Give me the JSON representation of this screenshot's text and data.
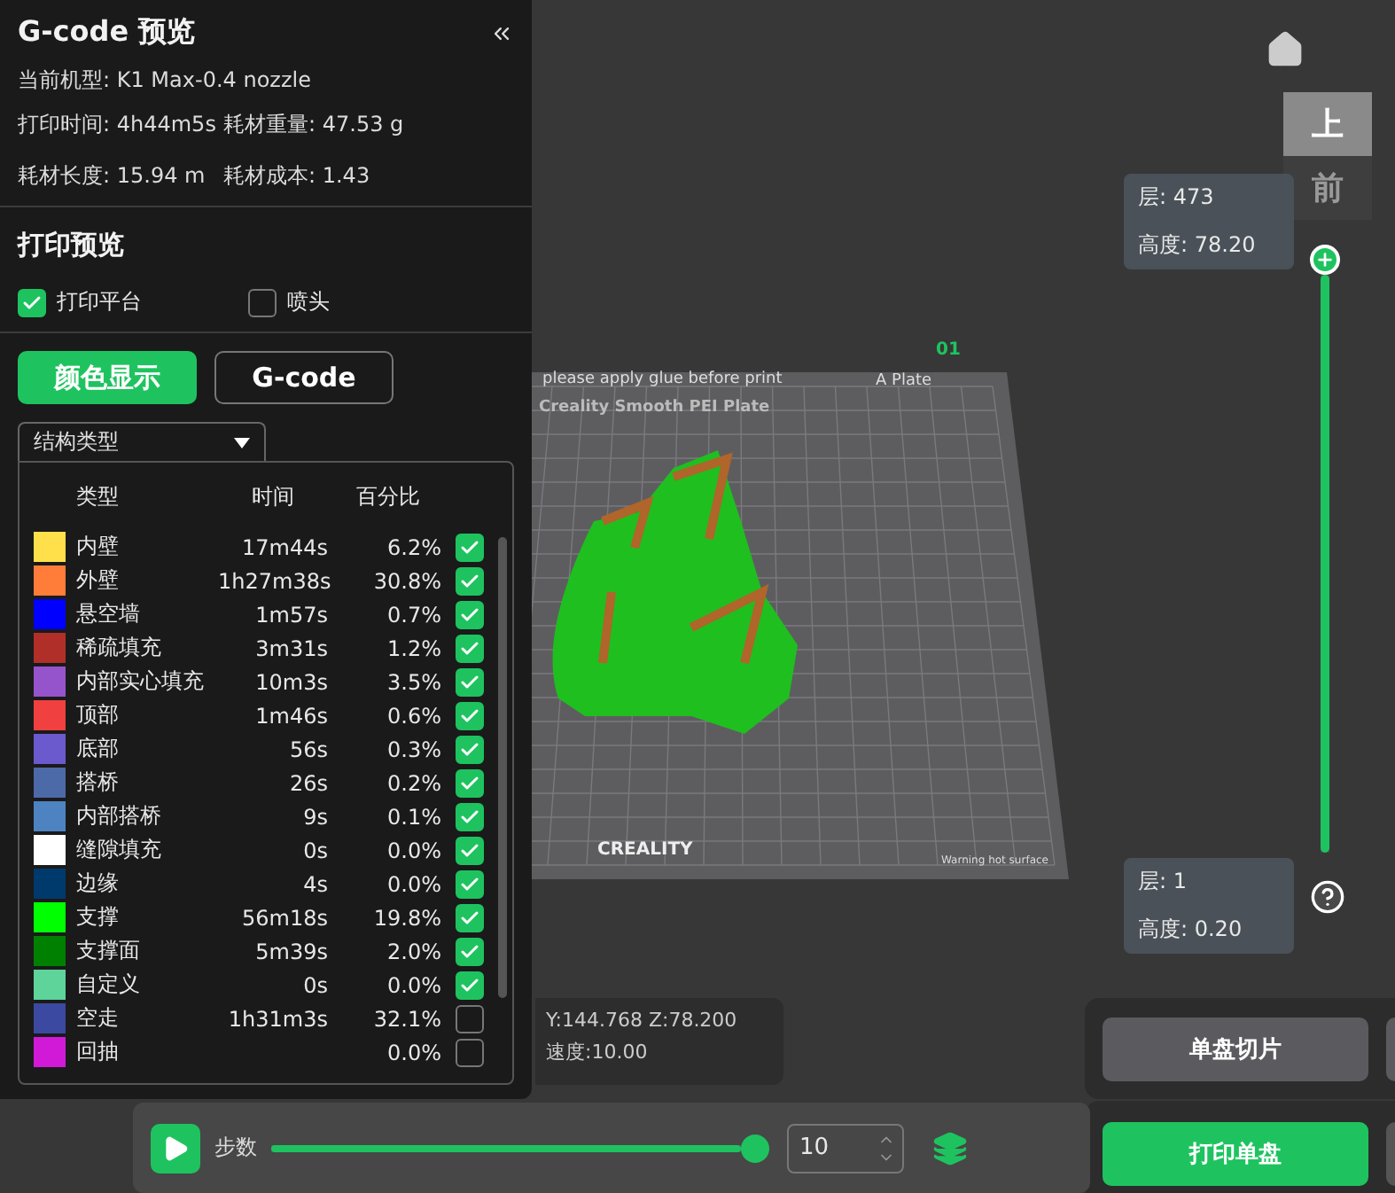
{
  "panel": {
    "title": "G-code 预览",
    "machine": "当前机型: K1 Max-0.4 nozzle",
    "stats": [
      "打印时间: 4h44m5s",
      "耗材重量: 47.53 g",
      "耗材长度: 15.94 m",
      "耗材成本: 1.43"
    ],
    "preview_title": "打印预览",
    "toggles": [
      {
        "label": "打印平台",
        "checked": true
      },
      {
        "label": "喷头",
        "checked": false
      }
    ],
    "modes": [
      {
        "label": "颜色显示",
        "selected": true
      },
      {
        "label": "G-code",
        "selected": false
      }
    ],
    "view_select": "结构类型",
    "legend": {
      "columns": [
        "类型",
        "时间",
        "百分比"
      ],
      "rows": [
        {
          "name": "内壁",
          "time": "17m44s",
          "percent": "6.2%",
          "color": "#ffe04a",
          "checked": true
        },
        {
          "name": "外壁",
          "time": "1h27m38s",
          "percent": "30.8%",
          "color": "#ff7d38",
          "checked": true
        },
        {
          "name": "悬空墙",
          "time": "1m57s",
          "percent": "0.7%",
          "color": "#0000ff",
          "checked": true
        },
        {
          "name": "稀疏填充",
          "time": "3m31s",
          "percent": "1.2%",
          "color": "#b03029",
          "checked": true
        },
        {
          "name": "内部实心填充",
          "time": "10m3s",
          "percent": "3.5%",
          "color": "#9654cc",
          "checked": true
        },
        {
          "name": "顶部",
          "time": "1m46s",
          "percent": "0.6%",
          "color": "#f04040",
          "checked": true
        },
        {
          "name": "底部",
          "time": "56s",
          "percent": "0.3%",
          "color": "#6b5acd",
          "checked": true
        },
        {
          "name": "搭桥",
          "time": "26s",
          "percent": "0.2%",
          "color": "#4d6aa8",
          "checked": true
        },
        {
          "name": "内部搭桥",
          "time": "9s",
          "percent": "0.1%",
          "color": "#4d83c0",
          "checked": true
        },
        {
          "name": "缝隙填充",
          "time": "0s",
          "percent": "0.0%",
          "color": "#ffffff",
          "checked": true
        },
        {
          "name": "边缘",
          "time": "4s",
          "percent": "0.0%",
          "color": "#00396b",
          "checked": true
        },
        {
          "name": "支撑",
          "time": "56m18s",
          "percent": "19.8%",
          "color": "#00ff00",
          "checked": true
        },
        {
          "name": "支撑面",
          "time": "5m39s",
          "percent": "2.0%",
          "color": "#008000",
          "checked": true
        },
        {
          "name": "自定义",
          "time": "0s",
          "percent": "0.0%",
          "color": "#5ed39a",
          "checked": true
        },
        {
          "name": "空走",
          "time": "1h31m3s",
          "percent": "32.1%",
          "color": "#3b49a0",
          "checked": false
        },
        {
          "name": "回抽",
          "time": "",
          "percent": "0.0%",
          "color": "#d01ad8",
          "checked": false
        }
      ]
    }
  },
  "plate": {
    "number": "01",
    "header": "please apply glue before print",
    "tab": "A Plate",
    "name": "Creality Smooth PEI Plate",
    "brand": "CREALITY",
    "warning": "Warning hot surface"
  },
  "view_cube": [
    "上",
    "前"
  ],
  "layer_slider": {
    "level": 1,
    "top": {
      "layer": "层: 473",
      "height": "高度: 78.20"
    },
    "bottom": {
      "layer": "层: 1",
      "height": "高度: 0.20"
    }
  },
  "coords": {
    "position": "Y:144.768  Z:78.200",
    "speed": "速度:10.00"
  },
  "step_bar": {
    "label": "步数",
    "level": 1,
    "value": "10"
  },
  "actions": [
    {
      "label": "单盘切片",
      "kind": "slice"
    },
    {
      "label": "打印单盘",
      "kind": "print"
    }
  ]
}
